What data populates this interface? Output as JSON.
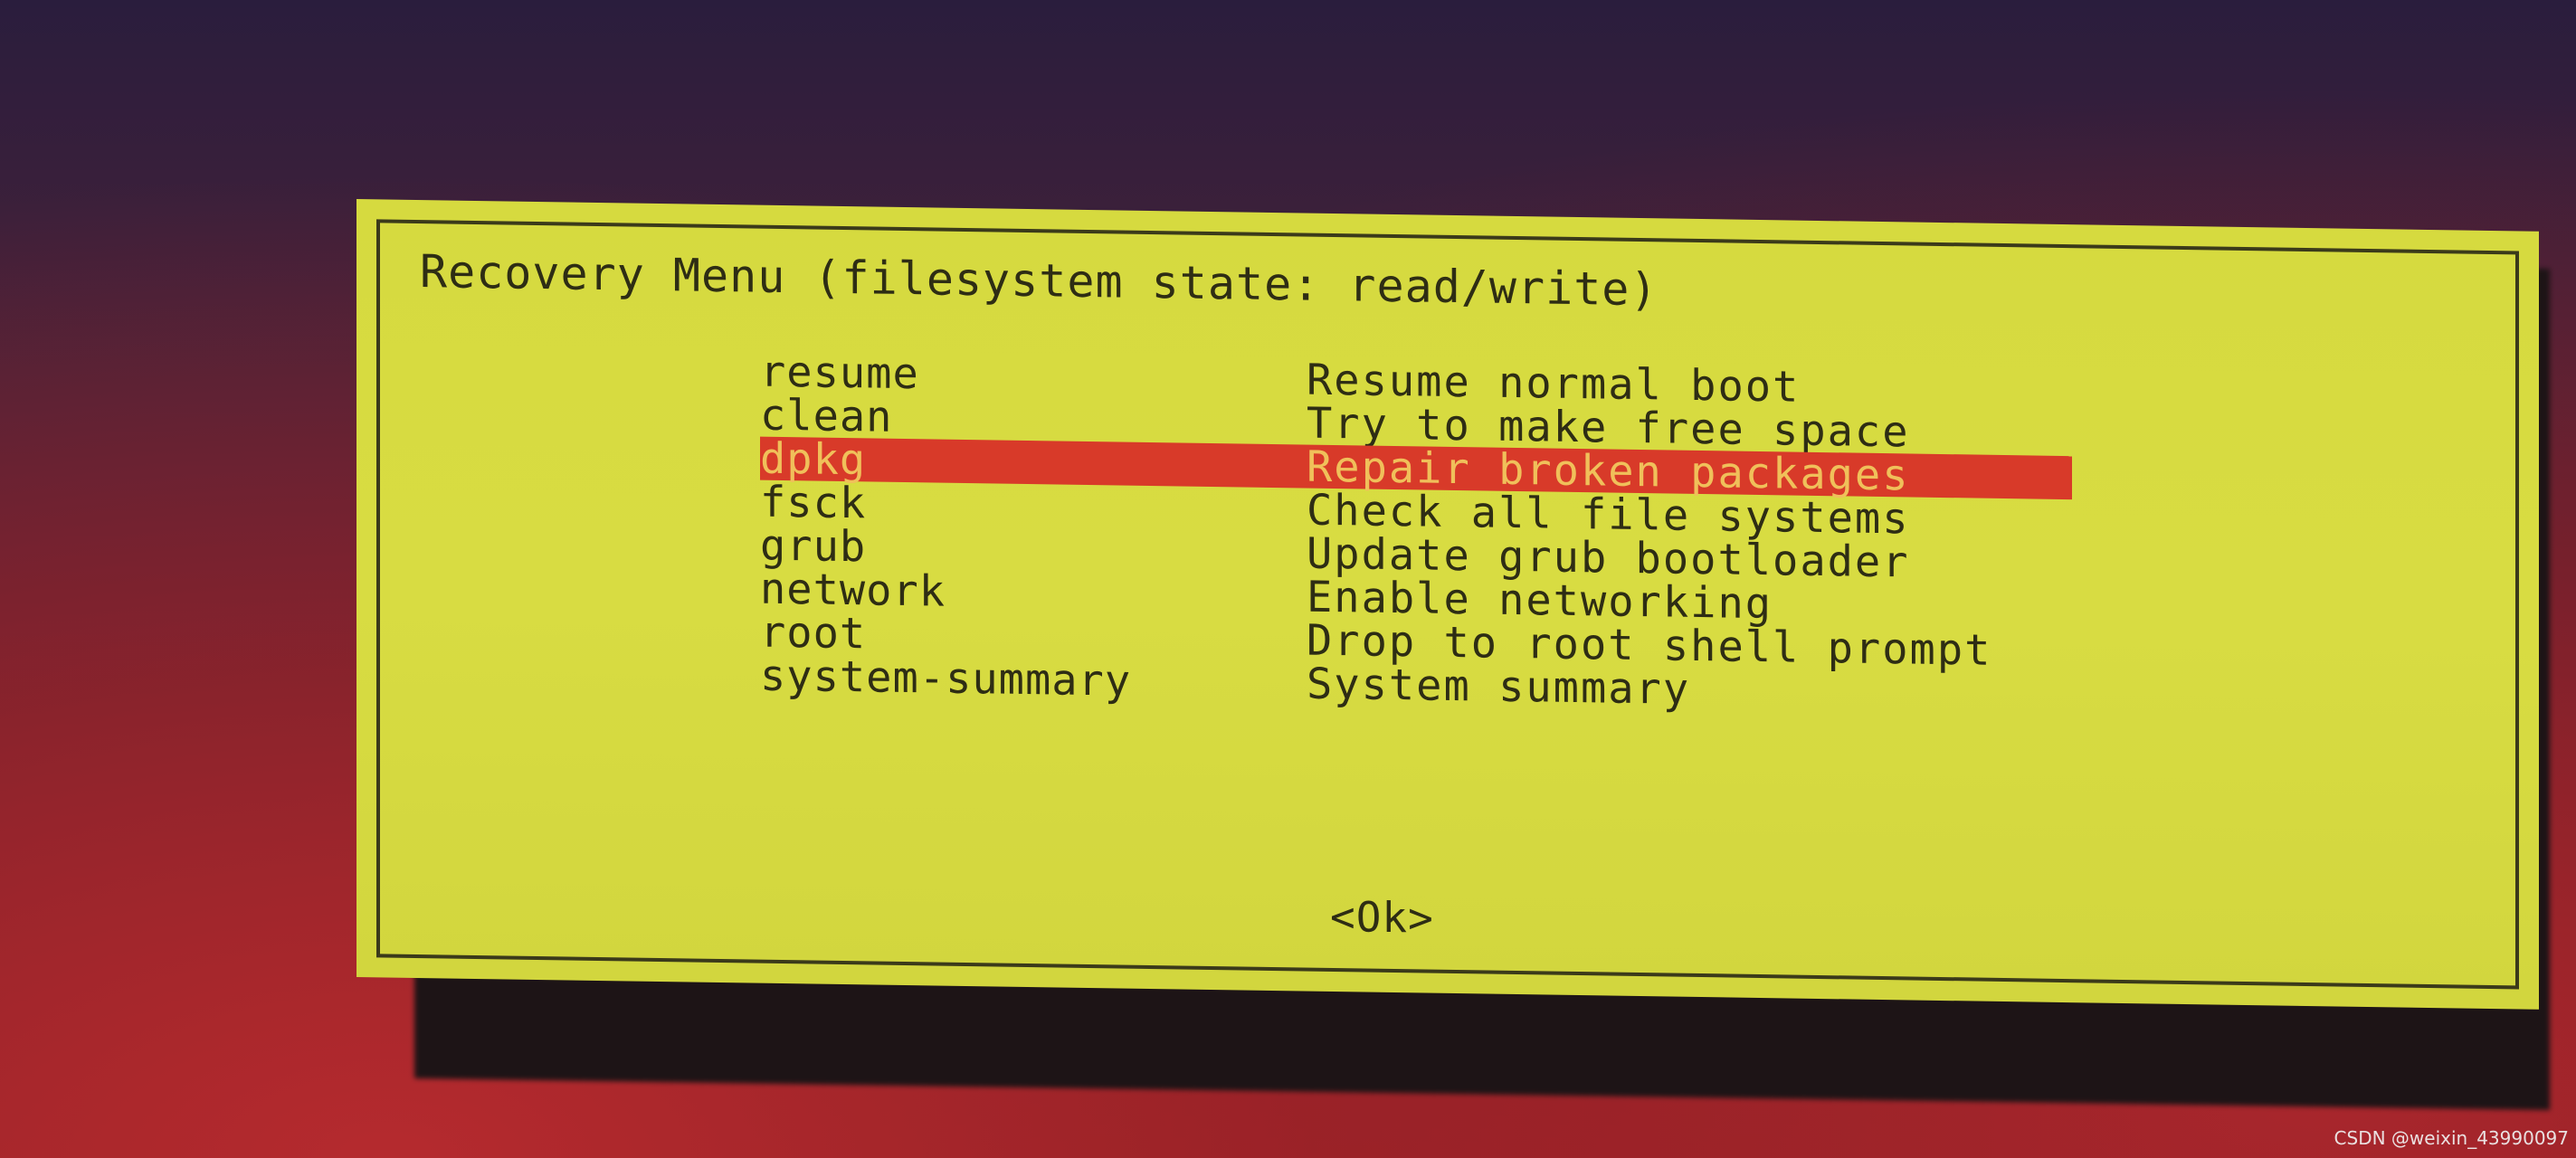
{
  "dialog": {
    "title": "Recovery Menu (filesystem state: read/write)",
    "items": [
      {
        "key": "resume",
        "desc": "Resume normal boot",
        "selected": false
      },
      {
        "key": "clean",
        "desc": "Try to make free space",
        "selected": false
      },
      {
        "key": "dpkg",
        "desc": "Repair broken packages",
        "selected": true
      },
      {
        "key": "fsck",
        "desc": "Check all file systems",
        "selected": false
      },
      {
        "key": "grub",
        "desc": "Update grub bootloader",
        "selected": false
      },
      {
        "key": "network",
        "desc": "Enable networking",
        "selected": false
      },
      {
        "key": "root",
        "desc": "Drop to root shell prompt",
        "selected": false
      },
      {
        "key": "system-summary",
        "desc": "System summary",
        "selected": false
      }
    ],
    "ok_label": "<Ok>"
  },
  "colors": {
    "dialog_bg": "#d6da3f",
    "highlight_bg": "#d83a29",
    "highlight_text": "#f0c05a",
    "text": "#2e2d14"
  },
  "watermark": "CSDN @weixin_43990097"
}
